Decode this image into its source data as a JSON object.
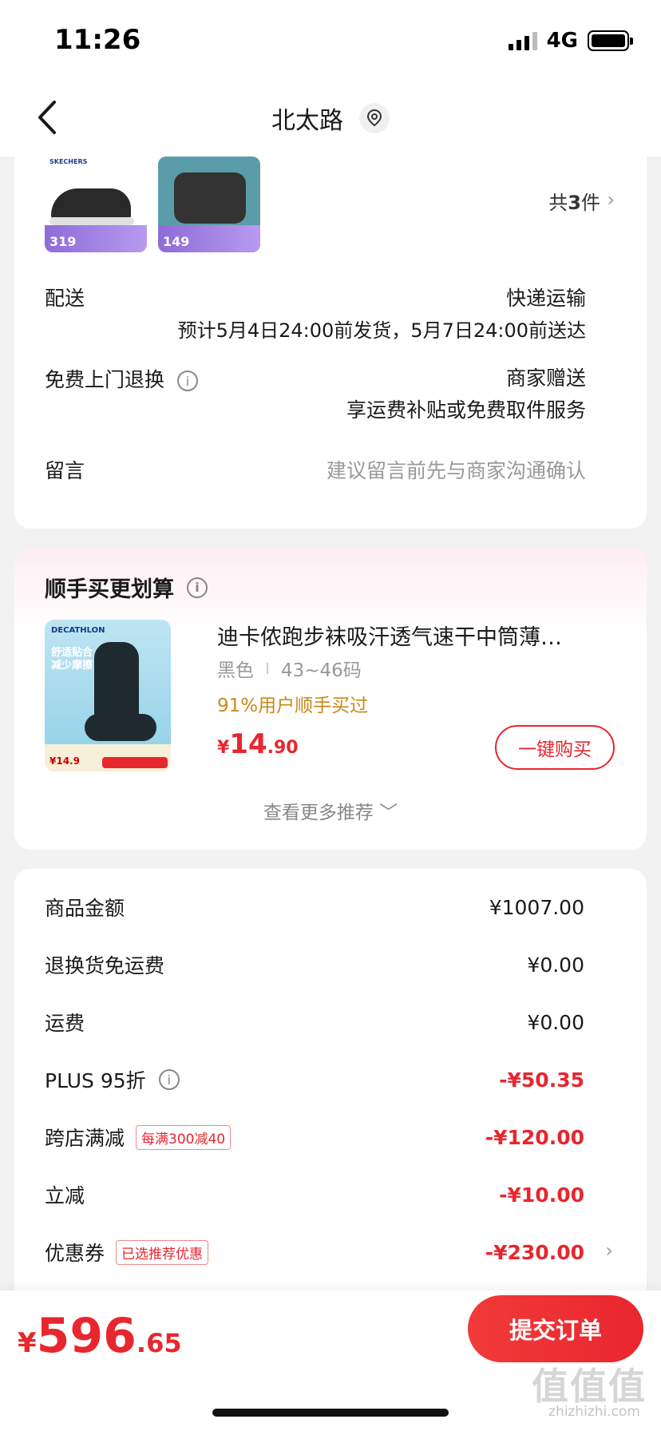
{
  "status_bar": {
    "time": "11:26",
    "network": "4G"
  },
  "nav": {
    "title": "北太路"
  },
  "order_items": {
    "thumb1_brand": "SKECHERS",
    "thumb1_price": "319",
    "thumb2_price": "149",
    "count_prefix": "共",
    "count": "3",
    "count_suffix": "件"
  },
  "delivery": {
    "label": "配送",
    "method": "快递运输",
    "estimate": "预计5月4日24:00前发货，5月7日24:00前送达"
  },
  "free_return": {
    "label": "免费上门退换",
    "provider": "商家赠送",
    "desc": "享运费补贴或免费取件服务"
  },
  "message": {
    "label": "留言",
    "placeholder": "建议留言前先与商家沟通确认"
  },
  "recommend": {
    "title": "顺手买更划算",
    "product": {
      "brand": "DECATHLON",
      "image_tag": "舒适贴合 减少摩擦",
      "image_price": "¥14.9",
      "name": "迪卡侬跑步袜吸汗透气速干中筒薄…",
      "color": "黑色",
      "size": "43~46码",
      "buyers": "91%用户顺手买过",
      "price_symbol": "¥",
      "price_int": "14",
      "price_dec": ".90",
      "buy_label": "一键购买"
    },
    "more_label": "查看更多推荐 ﹀"
  },
  "amounts": [
    {
      "label": "商品金额",
      "value": "¥1007.00"
    },
    {
      "label": "退换货免运费",
      "value": "¥0.00"
    },
    {
      "label": "运费",
      "value": "¥0.00"
    },
    {
      "label": "PLUS 95折",
      "value": "-¥50.35"
    },
    {
      "label": "跨店满减",
      "tag": "每满300减40",
      "value": "-¥120.00"
    },
    {
      "label": "立减",
      "value": "-¥10.00"
    },
    {
      "label": "优惠券",
      "tag": "已选推荐优惠",
      "value": "-¥230.00"
    }
  ],
  "footer": {
    "total_symbol": "¥",
    "total_int": "596",
    "total_dec": ".65",
    "submit_label": "提交订单",
    "watermark": "值值值",
    "watermark_sub": "zhizhizhi.com"
  },
  "colors": {
    "accent": "#e8262e",
    "gold": "#c8881a"
  }
}
